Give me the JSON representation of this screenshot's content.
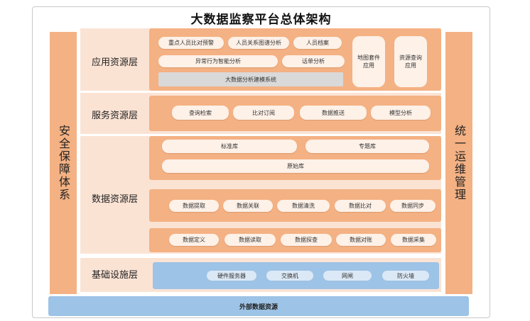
{
  "title": "大数据监察平台总体架构",
  "left_column": "安全保障体系",
  "right_column": "统一运维管理",
  "bottom": "外部数据资源",
  "application_layer": {
    "label": "应用资源层",
    "row1": [
      "重点人员比对预警",
      "人员关系图谱分析",
      "人员档案"
    ],
    "row2": [
      "异常行为智能分析",
      "话单分析"
    ],
    "bar": "大数据分析建模系统",
    "right": [
      "地图套件应用",
      "资源查询应用"
    ]
  },
  "service_layer": {
    "label": "服务资源层",
    "items": [
      "查询检索",
      "比对订阅",
      "数据推送",
      "模型分析"
    ]
  },
  "data_layer": {
    "label": "数据资源层",
    "libraries": [
      "标准库",
      "专题库",
      "原始库"
    ],
    "row1": [
      "数据提取",
      "数据关联",
      "数据清洗",
      "数据比对",
      "数据同步"
    ],
    "row2": [
      "数据定义",
      "数据读取",
      "数据探查",
      "数据对账",
      "数据采集"
    ]
  },
  "infra_layer": {
    "label": "基础设施层",
    "items": [
      "硬件服务器",
      "交换机",
      "网闸",
      "防火墙"
    ]
  }
}
